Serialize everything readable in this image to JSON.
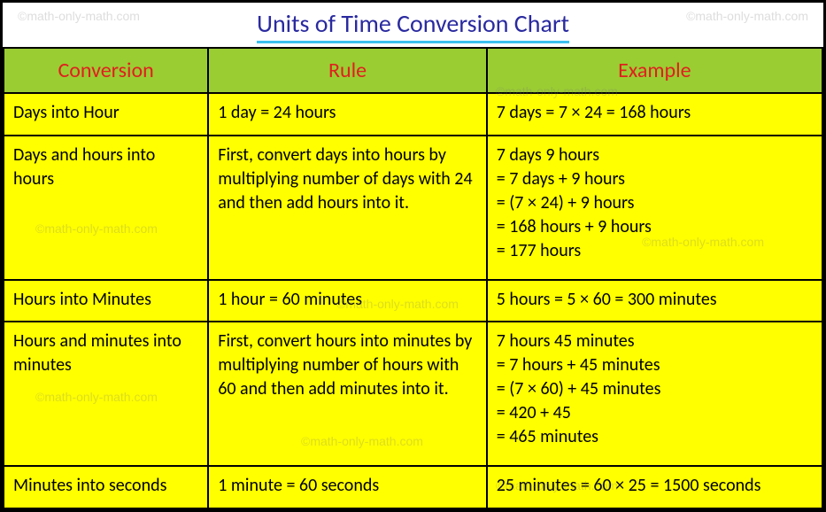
{
  "title": "Units of Time Conversion Chart",
  "watermark": "©math-only-math.com",
  "headers": {
    "conversion": "Conversion",
    "rule": "Rule",
    "example": "Example"
  },
  "chart_data": {
    "type": "table",
    "title": "Units of Time Conversion Chart",
    "columns": [
      "Conversion",
      "Rule",
      "Example"
    ],
    "rows": [
      {
        "conversion": "Days into Hour",
        "rule": "1 day = 24 hours",
        "example": "7 days = 7 × 24 = 168 hours"
      },
      {
        "conversion": "Days and hours into hours",
        "rule": "First, convert days into hours by multiplying number of days with 24 and then add hours into it.",
        "example": "7 days 9 hours\n= 7 days + 9 hours\n= (7 × 24) + 9 hours\n= 168 hours + 9 hours\n= 177 hours"
      },
      {
        "conversion": "Hours into Minutes",
        "rule": "1 hour = 60 minutes",
        "example": "5 hours = 5 × 60 = 300 minutes"
      },
      {
        "conversion": "Hours and minutes into minutes",
        "rule": "First, convert hours into minutes by multiplying number of hours with 60 and then add minutes into it.",
        "example": "7 hours 45 minutes\n= 7 hours + 45 minutes\n= (7 × 60) + 45 minutes\n= 420 + 45\n= 465 minutes"
      },
      {
        "conversion": "Minutes into seconds",
        "rule": "1 minute = 60 seconds",
        "example": "25 minutes = 60 × 25 = 1500 seconds"
      }
    ]
  }
}
